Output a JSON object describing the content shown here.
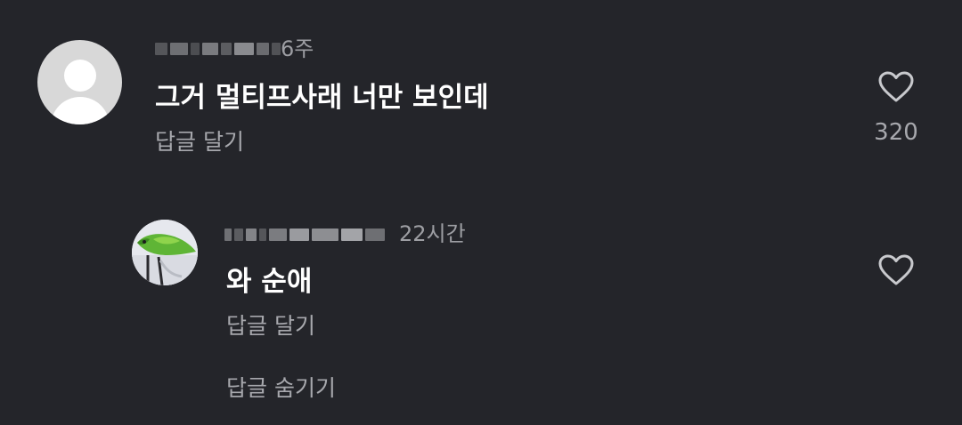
{
  "comment": {
    "time": "6주",
    "text": "그거 멀티프사래 너만 보인데",
    "reply_label": "답글 달기",
    "like_count": "320",
    "heart_icon": "heart-outline-icon"
  },
  "reply": {
    "time": "22시간",
    "text": "와 순애",
    "reply_label": "답글 달기",
    "heart_icon": "heart-outline-icon"
  },
  "hide_replies_label": "답글 숨기기",
  "colors": {
    "background": "#24252a",
    "primary_text": "#ffffff",
    "secondary_text": "#a7a8ad",
    "icon": "#c8c9cd"
  }
}
